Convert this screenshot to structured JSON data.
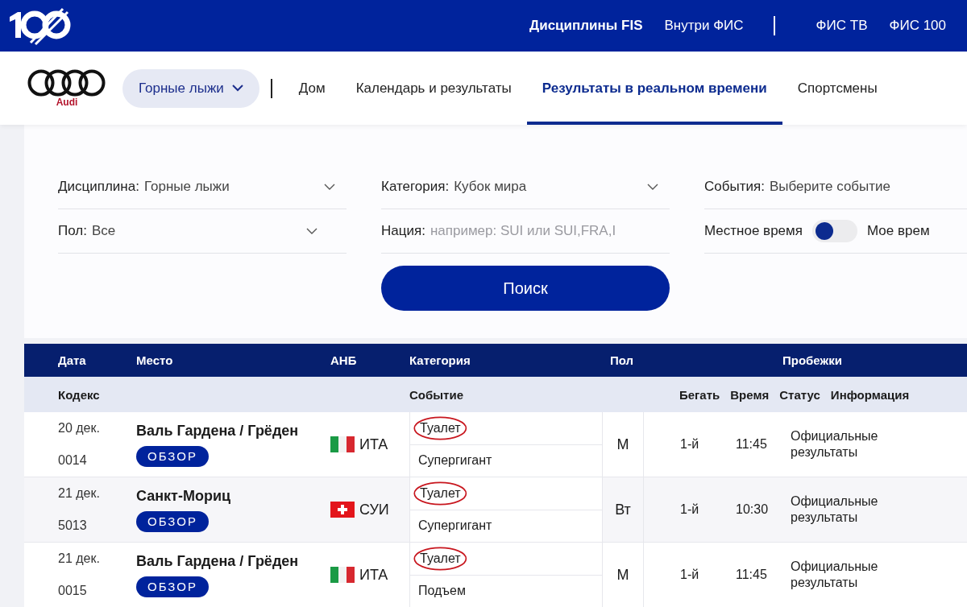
{
  "top_nav": {
    "items": [
      {
        "label": "Дисциплины FIS",
        "bold": true
      },
      {
        "label": "Внутри ФИС",
        "bold": false
      },
      {
        "label": "ФИС ТВ",
        "bold": false
      },
      {
        "label": "ФИС 100",
        "bold": false
      }
    ]
  },
  "sub_nav": {
    "sponsor": "Audi",
    "discipline": "Горные лыжи",
    "items": [
      {
        "label": "Дом",
        "selected": false
      },
      {
        "label": "Календарь и результаты",
        "selected": false
      },
      {
        "label": "Результаты в реальном времени",
        "selected": true
      },
      {
        "label": "Спортсмены",
        "selected": false
      }
    ]
  },
  "filters": {
    "discipline": {
      "label": "Дисциплина:",
      "value": "Горные лыжи"
    },
    "category": {
      "label": "Категория:",
      "value": "Кубок мира"
    },
    "events": {
      "label": "События:",
      "value": "Выберите событие"
    },
    "gender": {
      "label": "Пол:",
      "value": "Все"
    },
    "nation": {
      "label": "Нация:",
      "placeholder": "например: SUI или SUI,FRA,I"
    },
    "time": {
      "local": "Местное время",
      "mine": "Мое врем",
      "on": false
    },
    "search_button": "Поиск"
  },
  "table": {
    "columns": [
      "Дата",
      "Место",
      "АНБ",
      "Категория",
      "Пол",
      "Пробежки"
    ],
    "subcolumns": [
      "Кодекс",
      "Событие",
      "Бегать",
      "Время",
      "Статус",
      "Информация"
    ],
    "rows": [
      {
        "date": "20 дек.",
        "code": "0014",
        "place": "Валь Гардена / Грёден",
        "overview": "ОБЗОР",
        "kind": "italy",
        "nation": "ИТА",
        "category": "Туалет",
        "category_circled": true,
        "event": "Супергигант",
        "gender": "М",
        "run": "1-й",
        "time": "11:45",
        "status": "Официальные результаты"
      },
      {
        "date": "21 дек.",
        "code": "5013",
        "place": "Санкт-Мориц",
        "overview": "ОБЗОР",
        "kind": "switzerland",
        "nation": "СУИ",
        "category": "Туалет",
        "category_circled": true,
        "event": "Супергигант",
        "gender": "Вт",
        "run": "1-й",
        "time": "10:30",
        "status": "Официальные результаты"
      },
      {
        "date": "21 дек.",
        "code": "0015",
        "place": "Валь Гардена / Грёден",
        "overview": "ОБЗОР",
        "kind": "italy",
        "nation": "ИТА",
        "category": "Туалет",
        "category_circled": true,
        "event": "Подъем",
        "gender": "М",
        "run": "1-й",
        "time": "11:45",
        "status": "Официальные результаты"
      }
    ]
  }
}
